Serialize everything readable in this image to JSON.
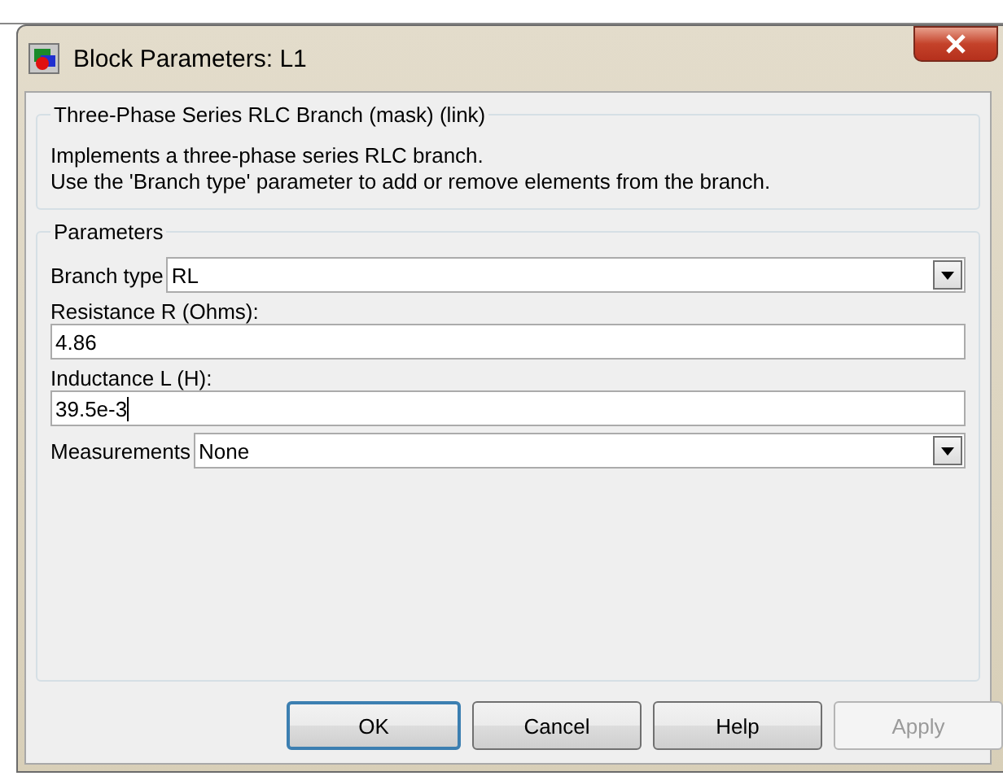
{
  "window": {
    "title": "Block Parameters: L1"
  },
  "description_group": {
    "title": "Three-Phase Series RLC Branch (mask) (link)",
    "lines": [
      "Implements a three-phase series RLC branch.",
      "Use the 'Branch type' parameter to add or remove elements from the branch."
    ]
  },
  "parameters_group": {
    "title": "Parameters",
    "fields": [
      {
        "kind": "dropdown",
        "label": "Branch type",
        "value": "RL"
      },
      {
        "kind": "text",
        "label": "Resistance R (Ohms):",
        "value": "4.86",
        "focused": false
      },
      {
        "kind": "text",
        "label": "Inductance L (H):",
        "value": "39.5e-3",
        "focused": true
      },
      {
        "kind": "dropdown",
        "label": "Measurements",
        "value": "None"
      }
    ]
  },
  "buttons": [
    {
      "label": "OK",
      "default": true,
      "disabled": false
    },
    {
      "label": "Cancel",
      "default": false,
      "disabled": false
    },
    {
      "label": "Help",
      "default": false,
      "disabled": false
    },
    {
      "label": "Apply",
      "default": false,
      "disabled": true
    }
  ]
}
